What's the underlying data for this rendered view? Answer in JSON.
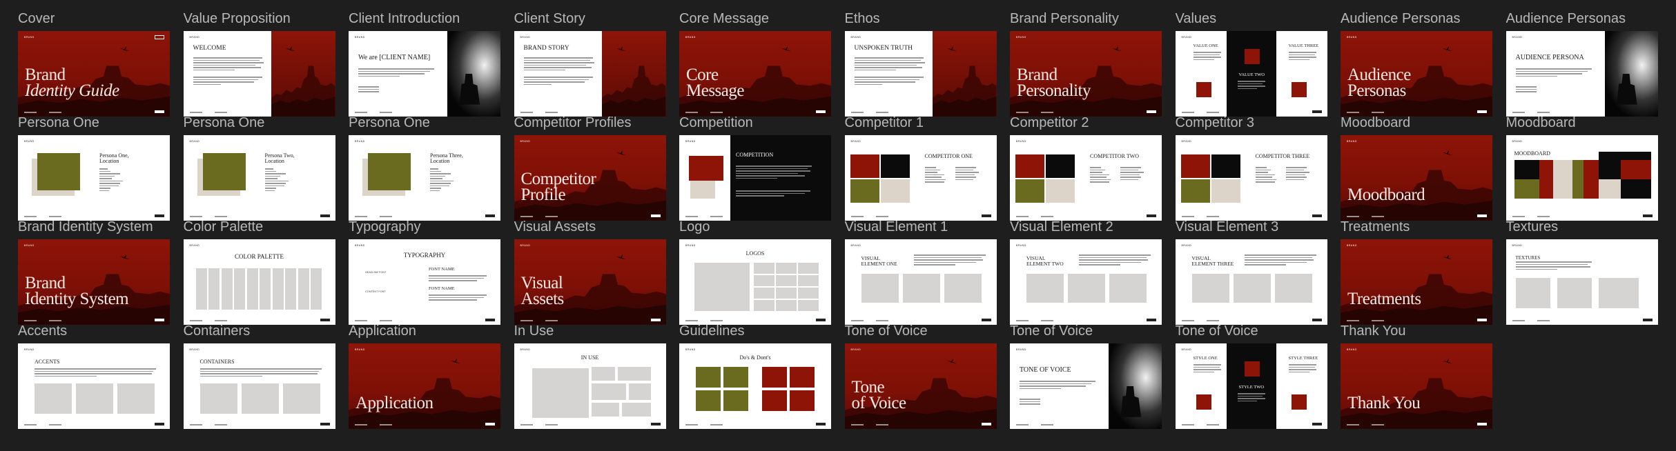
{
  "brand_logo": "BRAND",
  "slides": [
    {
      "label": "Cover",
      "kind": "red",
      "title": "Brand",
      "title_italic": "Identity Guide",
      "name": "slide-cover"
    },
    {
      "label": "Value Proposition",
      "kind": "text-redimg",
      "title": "WELCOME",
      "name": "slide-value-proposition"
    },
    {
      "label": "Client Introduction",
      "kind": "text-bw",
      "title": "We are [CLIENT NAME]",
      "name": "slide-client-introduction"
    },
    {
      "label": "Client Story",
      "kind": "text-redimg",
      "title": "BRAND STORY",
      "name": "slide-client-story"
    },
    {
      "label": "Core Message",
      "kind": "red",
      "title": "Core\nMessage",
      "name": "slide-core-message"
    },
    {
      "label": "Ethos",
      "kind": "text-redimg",
      "title": "UNSPOKEN TRUTH",
      "name": "slide-ethos"
    },
    {
      "label": "Brand Personality",
      "kind": "red",
      "title": "Brand\nPersonality",
      "name": "slide-brand-personality"
    },
    {
      "label": "Values",
      "kind": "values",
      "col1": "VALUE ONE",
      "col2": "VALUE TWO",
      "col3": "VALUE THREE",
      "name": "slide-values"
    },
    {
      "label": "Audience Personas",
      "kind": "red",
      "title": "Audience\nPersonas",
      "name": "slide-audience-personas-cover"
    },
    {
      "label": "Audience Personas",
      "kind": "text-bw",
      "title": "AUDIENCE PERSONA",
      "name": "slide-audience-persona"
    },
    {
      "label": "Persona One",
      "kind": "persona",
      "title": "Persona One,\nLocation",
      "name": "slide-persona-one"
    },
    {
      "label": "Persona One",
      "kind": "persona",
      "title": "Persona Two,\nLocation",
      "name": "slide-persona-two"
    },
    {
      "label": "Persona One",
      "kind": "persona",
      "title": "Persona Three,\nLocation",
      "name": "slide-persona-three"
    },
    {
      "label": "Competitor Profiles",
      "kind": "red",
      "title": "Competitor\nProfile",
      "name": "slide-competitor-profiles"
    },
    {
      "label": "Competition",
      "kind": "competition",
      "title": "COMPETITION",
      "name": "slide-competition"
    },
    {
      "label": "Competitor 1",
      "kind": "competitor",
      "title": "COMPETITOR ONE",
      "name": "slide-competitor-1"
    },
    {
      "label": "Competitor 2",
      "kind": "competitor",
      "title": "COMPETITOR TWO",
      "name": "slide-competitor-2"
    },
    {
      "label": "Competitor 3",
      "kind": "competitor",
      "title": "COMPETITOR THREE",
      "name": "slide-competitor-3"
    },
    {
      "label": "Moodboard",
      "kind": "red",
      "title": "Moodboard",
      "name": "slide-moodboard-cover"
    },
    {
      "label": "Moodboard",
      "kind": "moodboard",
      "title": "MOODBOARD",
      "name": "slide-moodboard"
    },
    {
      "label": "Brand Identity System",
      "kind": "red",
      "title": "Brand\nIdentity System",
      "name": "slide-brand-identity-system"
    },
    {
      "label": "Color Palette",
      "kind": "palette",
      "title": "COLOR PALETTE",
      "name": "slide-color-palette"
    },
    {
      "label": "Typography",
      "kind": "typography",
      "title": "TYPOGRAPHY",
      "font_name": "FONT NAME",
      "tag1": "HEADLINE FONT",
      "tag2": "CONTENT FONT",
      "name": "slide-typography"
    },
    {
      "label": "Visual Assets",
      "kind": "red",
      "title": "Visual\nAssets",
      "name": "slide-visual-assets"
    },
    {
      "label": "Logo",
      "kind": "logos",
      "title": "LOGOS",
      "name": "slide-logo"
    },
    {
      "label": "Visual Element 1",
      "kind": "visual",
      "title": "VISUAL\nELEMENT ONE",
      "name": "slide-visual-element-1"
    },
    {
      "label": "Visual Element 2",
      "kind": "visual",
      "title": "VISUAL\nELEMENT TWO",
      "name": "slide-visual-element-2"
    },
    {
      "label": "Visual Element 3",
      "kind": "visual",
      "title": "VISUAL\nELEMENT THREE",
      "name": "slide-visual-element-3"
    },
    {
      "label": "Treatments",
      "kind": "red",
      "title": "Treatments",
      "name": "slide-treatments"
    },
    {
      "label": "Textures",
      "kind": "textures",
      "title": "TEXTURES",
      "name": "slide-textures"
    },
    {
      "label": "Accents",
      "kind": "accents",
      "title": "ACCENTS",
      "name": "slide-accents"
    },
    {
      "label": "Containers",
      "kind": "accents",
      "title": "CONTAINERS",
      "name": "slide-containers"
    },
    {
      "label": "Application",
      "kind": "red",
      "title": "Application",
      "name": "slide-application"
    },
    {
      "label": "In Use",
      "kind": "inuse",
      "title": "IN USE",
      "name": "slide-in-use"
    },
    {
      "label": "Guidelines",
      "kind": "guidelines",
      "title": "Do's & Dont's",
      "name": "slide-guidelines"
    },
    {
      "label": "Tone of Voice",
      "kind": "red",
      "title": "Tone\nof Voice",
      "name": "slide-tone-of-voice-cover"
    },
    {
      "label": "Tone of Voice",
      "kind": "text-bw",
      "title": "TONE OF VOICE",
      "name": "slide-tone-of-voice"
    },
    {
      "label": "Tone of Voice",
      "kind": "values",
      "col1": "STYLE ONE",
      "col2": "STYLE TWO",
      "col3": "STYLE THREE",
      "name": "slide-tone-styles"
    },
    {
      "label": "Thank You",
      "kind": "red",
      "title": "Thank You",
      "name": "slide-thank-you"
    }
  ],
  "colors": {
    "background": "#1e1e1e",
    "brand_red": "#8e1408",
    "olive": "#6a6b1f",
    "cream": "#dcd4c8",
    "placeholder_gray": "#d6d4d2"
  }
}
